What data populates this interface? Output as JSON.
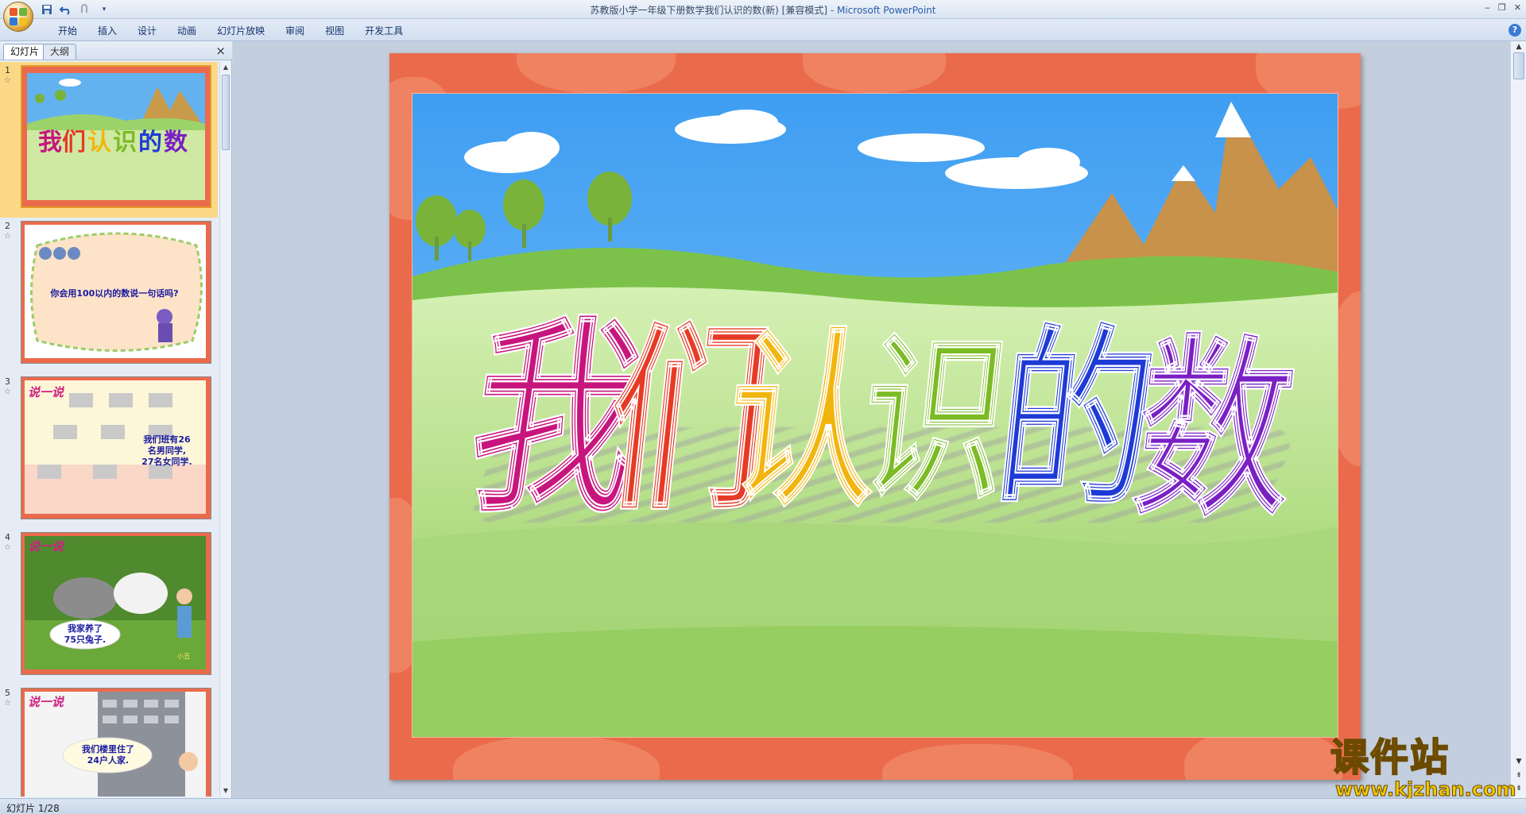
{
  "window": {
    "title": "苏教版小学一年级下册数学我们认识的数(新) [兼容模式]",
    "app_name": " - Microsoft PowerPoint",
    "controls": [
      "‒",
      "❐",
      "✕"
    ]
  },
  "qat": {
    "icons": [
      "save-icon",
      "undo-icon",
      "redo-icon",
      "customize-icon"
    ]
  },
  "ribbon": {
    "tabs": [
      "开始",
      "插入",
      "设计",
      "动画",
      "幻灯片放映",
      "审阅",
      "视图",
      "开发工具"
    ],
    "help": "?"
  },
  "left_pane": {
    "tabs": [
      "幻灯片",
      "大纲"
    ],
    "close": "×",
    "slides": [
      {
        "num": "1",
        "title": "我们认识的数"
      },
      {
        "num": "2",
        "text": "你会用100以内的数说一句话吗?"
      },
      {
        "num": "3",
        "heading": "说一说",
        "lines": [
          "我们班有26",
          "名男同学,",
          "27名女同学."
        ]
      },
      {
        "num": "4",
        "heading": "说一说",
        "lines": [
          "我家养了",
          "75只兔子."
        ],
        "tag": "小丑"
      },
      {
        "num": "5",
        "heading": "说一说",
        "lines": [
          "我们楼里住了",
          "24户人家."
        ]
      }
    ]
  },
  "main_slide": {
    "title_chars": [
      "我",
      "们",
      "认",
      "识",
      "的",
      "数"
    ],
    "char_colors": [
      "#c8157e",
      "#e63a25",
      "#f2b50e",
      "#7bbb24",
      "#1e3ad6",
      "#7a1fc4"
    ]
  },
  "watermark": {
    "text": "课件站",
    "url": "www.kjzhan.com"
  },
  "status": {
    "slide_indicator": "幻灯片 1/28"
  }
}
